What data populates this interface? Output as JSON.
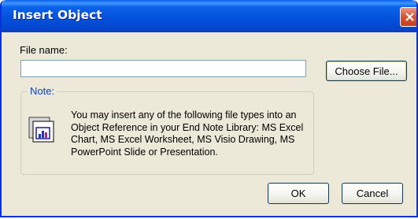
{
  "dialog": {
    "title": "Insert Object",
    "file_name_label": "File name:",
    "file_name_value": "",
    "choose_file_label": "Choose File...",
    "note_legend": "Note:",
    "note_text": "You may insert any of the following file types into an Object Reference in your End Note Library: MS Excel Chart, MS Excel Worksheet, MS Visio Drawing, MS PowerPoint Slide or Presentation.",
    "ok_label": "OK",
    "cancel_label": "Cancel",
    "icons": [
      "close-icon",
      "object-document-icon"
    ]
  },
  "colors": {
    "titlebar": "#0552dc",
    "window_face": "#ece9d8",
    "close_button": "#d6593a",
    "note_legend": "#0046d5"
  }
}
